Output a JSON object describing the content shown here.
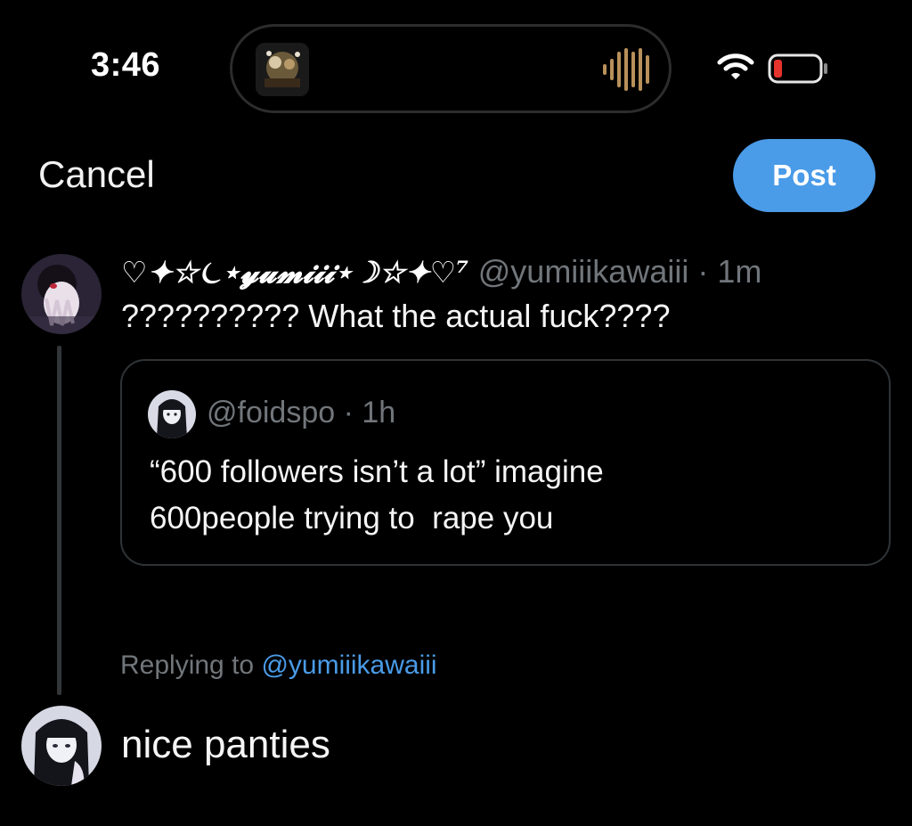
{
  "status_bar": {
    "time": "3:46",
    "icons": [
      "album-art-icon",
      "audio-waveform-icon",
      "wifi-icon",
      "battery-icon"
    ],
    "battery_color": "#e5342d"
  },
  "compose": {
    "cancel_label": "Cancel",
    "post_label": "Post",
    "accent_color": "#4a9be8"
  },
  "original_tweet": {
    "display_name": "♡✦☆⏾⋆𝔂𝓾𝓶𝓲𝓲𝓲⋆☽☆✦♡⁷",
    "handle": "@yumiiikawaiii",
    "separator": " · ",
    "time": "1m",
    "text": "?????????? What the actual fuck????"
  },
  "quoted_tweet": {
    "handle": "@foidspo",
    "separator": " · ",
    "time": "1h",
    "lines": [
      "“600 followers isn’t a lot” imagine",
      "600people trying to  rape you"
    ]
  },
  "reply": {
    "replying_prefix": "Replying to ",
    "replying_handle": "@yumiiikawaiii",
    "text": "nice panties"
  }
}
